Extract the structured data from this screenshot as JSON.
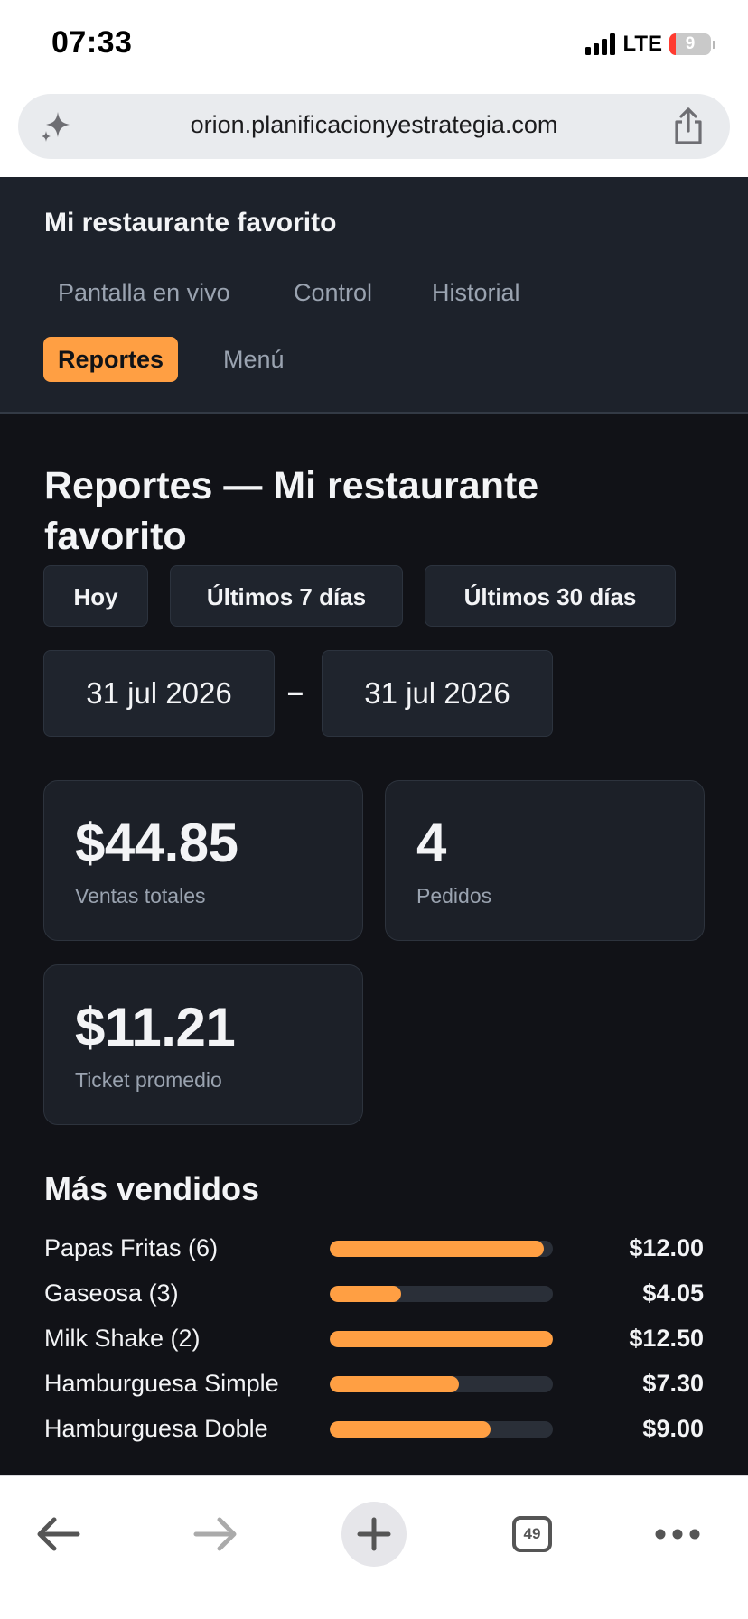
{
  "status_bar": {
    "time": "07:33",
    "network": "LTE",
    "battery": "9"
  },
  "browser": {
    "url": "orion.planificacionyestrategia.com",
    "tabs_count": "49",
    "icons": [
      "sparkle-icon",
      "share-icon",
      "back-arrow-icon",
      "forward-arrow-icon",
      "plus-icon",
      "tabs-icon",
      "more-icon"
    ]
  },
  "header": {
    "title": "Mi restaurante favorito",
    "nav": [
      {
        "label": "Pantalla en vivo",
        "active": false
      },
      {
        "label": "Control",
        "active": false
      },
      {
        "label": "Historial",
        "active": false
      },
      {
        "label": "Reportes",
        "active": true
      },
      {
        "label": "Menú",
        "active": false
      }
    ]
  },
  "main": {
    "title": "Reportes — Mi restaurante favorito",
    "ranges": [
      "Hoy",
      "Últimos 7 días",
      "Últimos 30 días"
    ],
    "date_from": "31 jul 2026",
    "date_separator": "–",
    "date_to": "31 jul 2026",
    "stats": [
      {
        "value": "$44.85",
        "label": "Ventas totales"
      },
      {
        "value": "4",
        "label": "Pedidos"
      },
      {
        "value": "$11.21",
        "label": "Ticket promedio"
      }
    ],
    "best_sellers": {
      "title": "Más vendidos",
      "items": [
        {
          "name": "Papas Fritas (6)",
          "amount": "$12.00",
          "fill": 0.96
        },
        {
          "name": "Gaseosa (3)",
          "amount": "$4.05",
          "fill": 0.32
        },
        {
          "name": "Milk Shake (2)",
          "amount": "$12.50",
          "fill": 1.0
        },
        {
          "name": "Hamburguesa Simple",
          "amount": "$7.30",
          "fill": 0.58
        },
        {
          "name": "Hamburguesa Doble",
          "amount": "$9.00",
          "fill": 0.72
        }
      ]
    }
  },
  "colors": {
    "accent": "#ff9f43",
    "header_bg": "#1d222b",
    "page_bg": "#111217",
    "card_bg": "#1c2028"
  }
}
